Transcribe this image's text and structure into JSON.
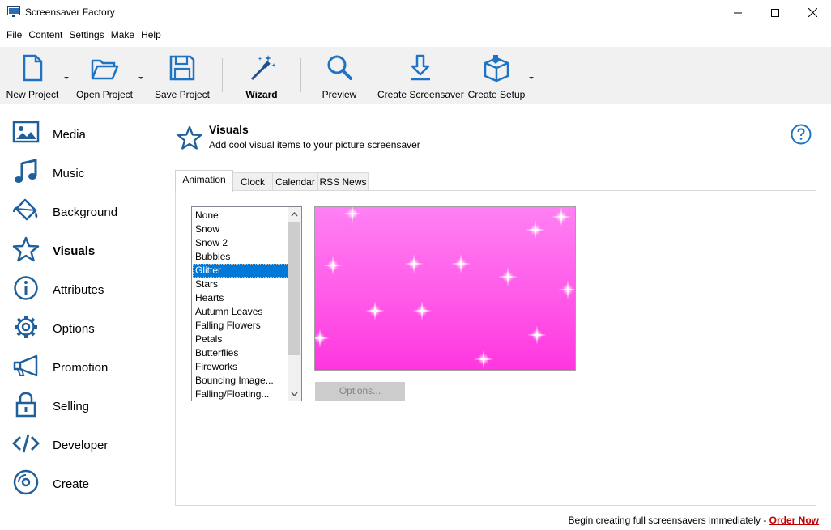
{
  "window": {
    "title": "Screensaver Factory"
  },
  "menu": [
    "File",
    "Content",
    "Settings",
    "Make",
    "Help"
  ],
  "toolbar": {
    "new_project": "New Project",
    "open_project": "Open Project",
    "save_project": "Save Project",
    "wizard": "Wizard",
    "preview": "Preview",
    "create_screensaver": "Create Screensaver",
    "create_setup": "Create Setup"
  },
  "sidebar": {
    "items": [
      {
        "label": "Media",
        "icon": "image-icon"
      },
      {
        "label": "Music",
        "icon": "music-note-icon"
      },
      {
        "label": "Background",
        "icon": "paint-bucket-icon"
      },
      {
        "label": "Visuals",
        "icon": "star-icon",
        "active": true
      },
      {
        "label": "Attributes",
        "icon": "info-icon"
      },
      {
        "label": "Options",
        "icon": "gear-icon"
      },
      {
        "label": "Promotion",
        "icon": "megaphone-icon"
      },
      {
        "label": "Selling",
        "icon": "lock-icon"
      },
      {
        "label": "Developer",
        "icon": "code-icon"
      },
      {
        "label": "Create",
        "icon": "disc-icon"
      }
    ]
  },
  "header": {
    "title": "Visuals",
    "subtitle": "Add cool visual items to your picture screensaver"
  },
  "tabs": [
    "Animation",
    "Clock",
    "Calendar",
    "RSS News"
  ],
  "active_tab": "Animation",
  "animation_list": {
    "items": [
      "None",
      "Snow",
      "Snow 2",
      "Bubbles",
      "Glitter",
      "Stars",
      "Hearts",
      "Autumn Leaves",
      "Falling Flowers",
      "Petals",
      "Butterflies",
      "Fireworks",
      "Bouncing Image...",
      "Falling/Floating..."
    ],
    "selected": "Glitter"
  },
  "options_button": "Options...",
  "footer": {
    "text": "Begin creating full screensavers immediately - ",
    "link": "Order Now"
  },
  "colors": {
    "accent": "#0078d7",
    "icon_blue": "#1f5f9b",
    "preview_pink": "#ff5ae8",
    "link_red": "#c00000"
  }
}
